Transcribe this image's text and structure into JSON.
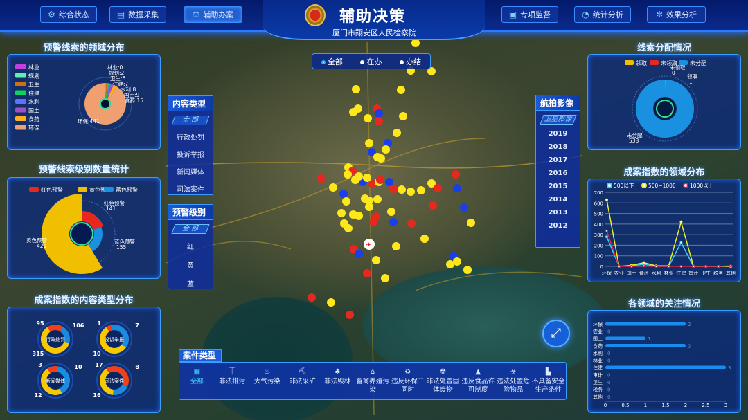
{
  "header": {
    "title": "辅助决策",
    "subtitle": "厦门市翔安区人民检察院",
    "nav_left": [
      {
        "label": "综合状态",
        "icon": "status-icon"
      },
      {
        "label": "数据采集",
        "icon": "data-collect-icon"
      },
      {
        "label": "辅助办案",
        "icon": "gavel-icon",
        "active": true
      }
    ],
    "nav_right": [
      {
        "label": "专项监督",
        "icon": "monitor-icon"
      },
      {
        "label": "统计分析",
        "icon": "stats-icon"
      },
      {
        "label": "效果分析",
        "icon": "atom-icon"
      }
    ]
  },
  "map": {
    "filters": [
      {
        "label": "全部",
        "selected": true
      },
      {
        "label": "在办"
      },
      {
        "label": "办结"
      }
    ],
    "content_type": {
      "title": "内容类型",
      "all": "全 部",
      "items": [
        "行政处罚",
        "投诉举报",
        "新闻媒体",
        "司法案件"
      ]
    },
    "warning_level": {
      "title": "预警级别",
      "all": "全 部",
      "items": [
        "红",
        "黄",
        "蓝"
      ]
    },
    "aerial": {
      "title": "航拍影像",
      "selected": "卫星影像",
      "years": [
        "2019",
        "2018",
        "2017",
        "2016",
        "2015",
        "2014",
        "2013",
        "2012"
      ]
    },
    "case_types": {
      "title": "案件类型",
      "items": [
        {
          "label": "全部",
          "icon": "grid-icon",
          "selected": true
        },
        {
          "label": "非法排污",
          "icon": "outlet-icon"
        },
        {
          "label": "大气污染",
          "icon": "factory-smoke-icon"
        },
        {
          "label": "非法采矿",
          "icon": "mining-icon"
        },
        {
          "label": "非法毁林",
          "icon": "tree-icon"
        },
        {
          "label": "畜禽养殖污染",
          "icon": "farm-icon"
        },
        {
          "label": "违反环保三同时",
          "icon": "recycle-icon"
        },
        {
          "label": "非法处置固体废物",
          "icon": "waste-icon"
        },
        {
          "label": "违反食品许可制度",
          "icon": "food-icon"
        },
        {
          "label": "违法处置危险物品",
          "icon": "biohazard-icon"
        },
        {
          "label": "不具备安全生产条件",
          "icon": "factory-icon"
        }
      ]
    },
    "marker_colors": {
      "red": "#e8281e",
      "yellow": "#ffe81a",
      "blue": "#1a3ee8"
    }
  },
  "chart_data": [
    {
      "id": "domain",
      "title": "预警线索的领域分布",
      "type": "pie",
      "categories": [
        "林业",
        "规划",
        "卫生",
        "住建",
        "水利",
        "国土",
        "食药",
        "环保"
      ],
      "values": [
        0,
        2,
        6,
        7,
        8,
        9,
        15,
        441
      ],
      "colors": [
        "#c040e0",
        "#60f0b0",
        "#d07010",
        "#10d060",
        "#6070ff",
        "#a050c0",
        "#ffb020",
        "#f0a070"
      ]
    },
    {
      "id": "level",
      "title": "预警线索级别数量统计",
      "type": "pie",
      "categories": [
        "红色预警",
        "黄色预警",
        "蓝色预警"
      ],
      "values": [
        141,
        421,
        155
      ],
      "colors": [
        "#e8281e",
        "#f0c000",
        "#1a90e0"
      ]
    },
    {
      "id": "content",
      "title": "成案指数的内容类型分布",
      "type": "pie",
      "groups": [
        {
          "name": "行政处罚",
          "values": [
            95,
            106,
            315
          ]
        },
        {
          "name": "投诉举报",
          "values": [
            1,
            7,
            10
          ]
        },
        {
          "name": "新闻媒体",
          "values": [
            3,
            10,
            12
          ]
        },
        {
          "name": "司法案件",
          "values": [
            17,
            8,
            16
          ]
        }
      ],
      "colors": [
        "#f04018",
        "#1a8ce0",
        "#f8c800"
      ]
    },
    {
      "id": "alloc",
      "title": "线索分配情况",
      "type": "pie",
      "categories": [
        "领取",
        "未领取",
        "未分配"
      ],
      "values": [
        1,
        0,
        538
      ],
      "colors": [
        "#f0c000",
        "#e8281e",
        "#1a90e0"
      ]
    },
    {
      "id": "trend",
      "title": "成案指数的领域分布",
      "type": "line",
      "categories": [
        "环保",
        "农业",
        "国土",
        "食药",
        "水利",
        "林业",
        "住建",
        "审计",
        "卫生",
        "税务",
        "其他"
      ],
      "ylim": [
        0,
        700
      ],
      "yticks": [
        0,
        100,
        200,
        300,
        400,
        500,
        600,
        700
      ],
      "grid": true,
      "legend": "top",
      "series": [
        {
          "name": "500以下",
          "color": "#40d0f0",
          "values": [
            280,
            0,
            5,
            20,
            0,
            0,
            225,
            0,
            0,
            0,
            0
          ]
        },
        {
          "name": "500~1000",
          "color": "#f0f020",
          "values": [
            630,
            0,
            10,
            35,
            5,
            5,
            420,
            0,
            0,
            0,
            0
          ]
        },
        {
          "name": "1000以上",
          "color": "#e02040",
          "values": [
            335,
            0,
            0,
            5,
            0,
            0,
            0,
            0,
            0,
            0,
            5
          ]
        }
      ]
    },
    {
      "id": "attention",
      "title": "各领域的关注情况",
      "type": "bar",
      "orientation": "horizontal",
      "categories": [
        "环保",
        "农业",
        "国土",
        "食药",
        "水利",
        "林业",
        "住建",
        "审计",
        "卫生",
        "税务",
        "其他"
      ],
      "values": [
        2,
        0,
        1,
        2,
        0,
        0,
        3,
        0,
        0,
        0,
        0
      ],
      "xlim": [
        0,
        3
      ],
      "xticks": [
        "0",
        "0.5",
        "1",
        "1.5",
        "2",
        "2.5",
        "3"
      ],
      "color": "#1a8cf0"
    }
  ]
}
